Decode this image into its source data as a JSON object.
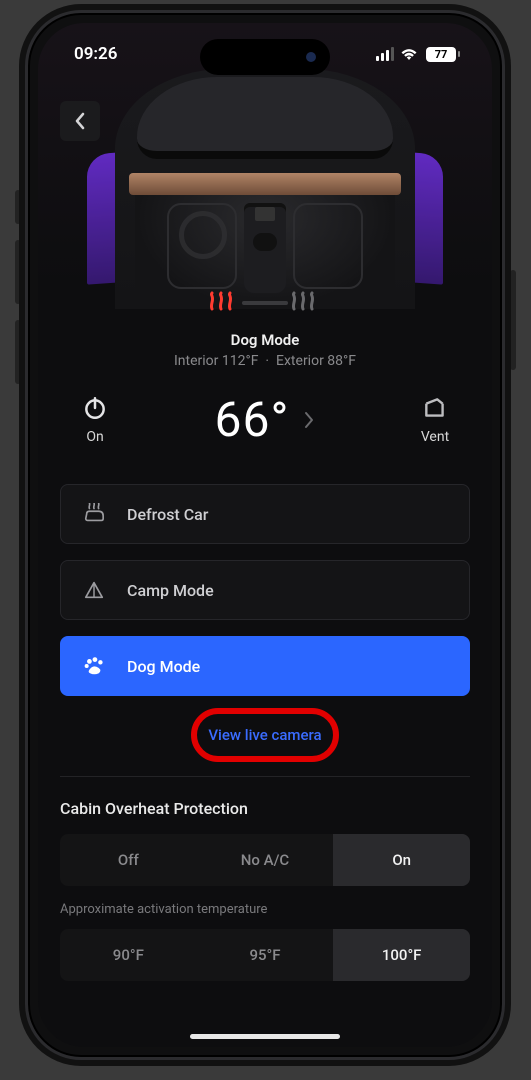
{
  "status_bar": {
    "time": "09:26",
    "battery_pct": "77"
  },
  "mode": {
    "title": "Dog Mode",
    "interior_label": "Interior 112°F",
    "separator": "·",
    "exterior_label": "Exterior 88°F"
  },
  "controls": {
    "power_label": "On",
    "temp": "66°",
    "vent_label": "Vent"
  },
  "options": {
    "defrost": "Defrost Car",
    "camp": "Camp Mode",
    "dog": "Dog Mode"
  },
  "live_camera_link": "View live camera",
  "overheat": {
    "title": "Cabin Overheat Protection",
    "off": "Off",
    "noac": "No A/C",
    "on": "On",
    "selected": "On"
  },
  "approx_label": "Approximate activation temperature",
  "temps": {
    "t1": "90°F",
    "t2": "95°F",
    "t3": "100°F",
    "selected": "100°F"
  }
}
